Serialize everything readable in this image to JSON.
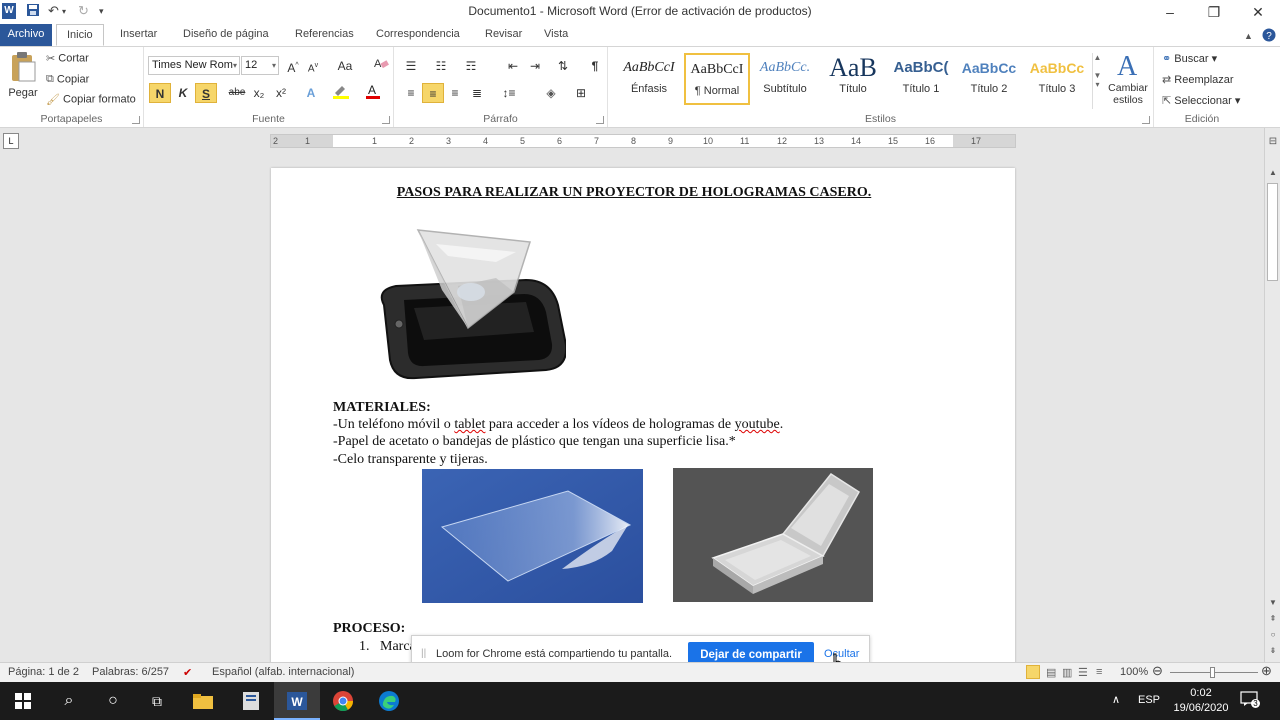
{
  "window": {
    "title": "Documento1  -  Microsoft Word (Error de activación de productos)",
    "logo_letter": "W"
  },
  "tabs": [
    "Archivo",
    "Inicio",
    "Insertar",
    "Diseño de página",
    "Referencias",
    "Correspondencia",
    "Revisar",
    "Vista"
  ],
  "ribbon": {
    "clipboard": {
      "paste": "Pegar",
      "cut": "Cortar",
      "copy": "Copiar",
      "format_painter": "Copiar formato",
      "label": "Portapapeles"
    },
    "font": {
      "name": "Times New Rom",
      "size": "12",
      "bold": "N",
      "italic": "K",
      "underline": "S",
      "strike": "abe",
      "sub": "x₂",
      "sup": "x²",
      "case": "Aa",
      "label": "Fuente"
    },
    "paragraph": {
      "label": "Párrafo",
      "pilcrow": "¶"
    },
    "styles": {
      "label": "Estilos",
      "items": [
        {
          "sample": "AaBbCcI",
          "name": "Énfasis"
        },
        {
          "sample": "AaBbCcI",
          "name": "¶ Normal"
        },
        {
          "sample": "AaBbCc.",
          "name": "Subtítulo"
        },
        {
          "sample": "AaB",
          "name": "Título"
        },
        {
          "sample": "AaBbC(",
          "name": "Título 1"
        },
        {
          "sample": "AaBbCc",
          "name": "Título 2"
        },
        {
          "sample": "AaBbCc",
          "name": "Título 3"
        }
      ],
      "change": "Cambiar estilos"
    },
    "editing": {
      "find": "Buscar",
      "replace": "Reemplazar",
      "select": "Seleccionar",
      "label": "Edición"
    }
  },
  "ruler": {
    "numbers": [
      "1",
      "2",
      "1",
      "2",
      "3",
      "4",
      "5",
      "6",
      "7",
      "8",
      "9",
      "10",
      "11",
      "12",
      "13",
      "14",
      "15",
      "16",
      "17"
    ]
  },
  "document": {
    "title": "PASOS PARA REALIZAR UN PROYECTOR DE HOLOGRAMAS CASERO.",
    "materials_heading": "MATERIALES:",
    "line1_a": "-Un teléfono móvil o ",
    "line1_b": "tablet",
    "line1_c": " para acceder a los vídeos de hologramas de ",
    "line1_d": "youtube",
    "line1_e": ".",
    "line2": "-Papel de acetato o bandejas de plástico que tengan una superficie lisa.*",
    "line3": "-Celo transparente y tijeras.",
    "process_heading": "PROCESO:",
    "step1_num": "1.",
    "step1_text": "Marca"
  },
  "loom": {
    "message": "Loom for Chrome está compartiendo tu pantalla.",
    "stop": "Dejar de compartir",
    "hide": "Ocultar"
  },
  "status": {
    "page": "Página: 1 de 2",
    "words": "Palabras: 6/257",
    "language": "Español (alfab. internacional)",
    "zoom": "100%"
  },
  "taskbar": {
    "lang": "ESP",
    "time": "0:02",
    "date": "19/06/2020",
    "notif_count": "3"
  },
  "colors": {
    "word_blue": "#2b579a",
    "loom_blue": "#1a73e8"
  }
}
